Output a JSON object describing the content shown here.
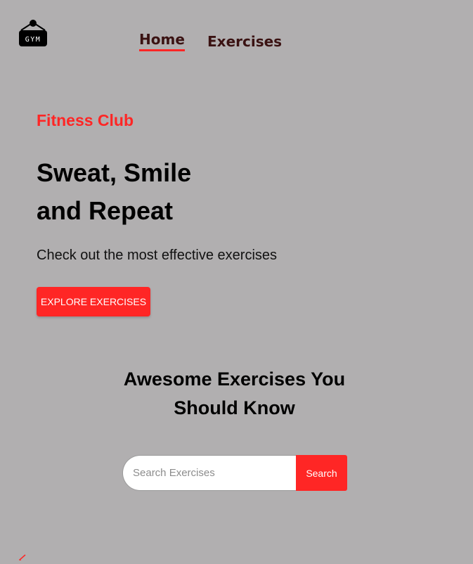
{
  "navbar": {
    "logo_text": "GYM",
    "links": [
      {
        "label": "Home",
        "active": true
      },
      {
        "label": "Exercises",
        "active": false
      }
    ]
  },
  "hero": {
    "tagline": "Fitness Club",
    "title_line1": "Sweat, Smile",
    "title_line2": "and Repeat",
    "subtitle": "Check out the most effective exercises",
    "cta_label": "Explore Exercises"
  },
  "search_section": {
    "title_line1": "Awesome Exercises You",
    "title_line2": "Should Know",
    "placeholder": "Search Exercises",
    "value": "",
    "button_label": "Search"
  },
  "icons": {
    "logo": "gym-logo-icon",
    "scroll": "chevron-left-icon"
  },
  "colors": {
    "background": "#b1afb0",
    "accent": "#ff2625",
    "nav_text": "#3a1212",
    "text": "#000000"
  }
}
